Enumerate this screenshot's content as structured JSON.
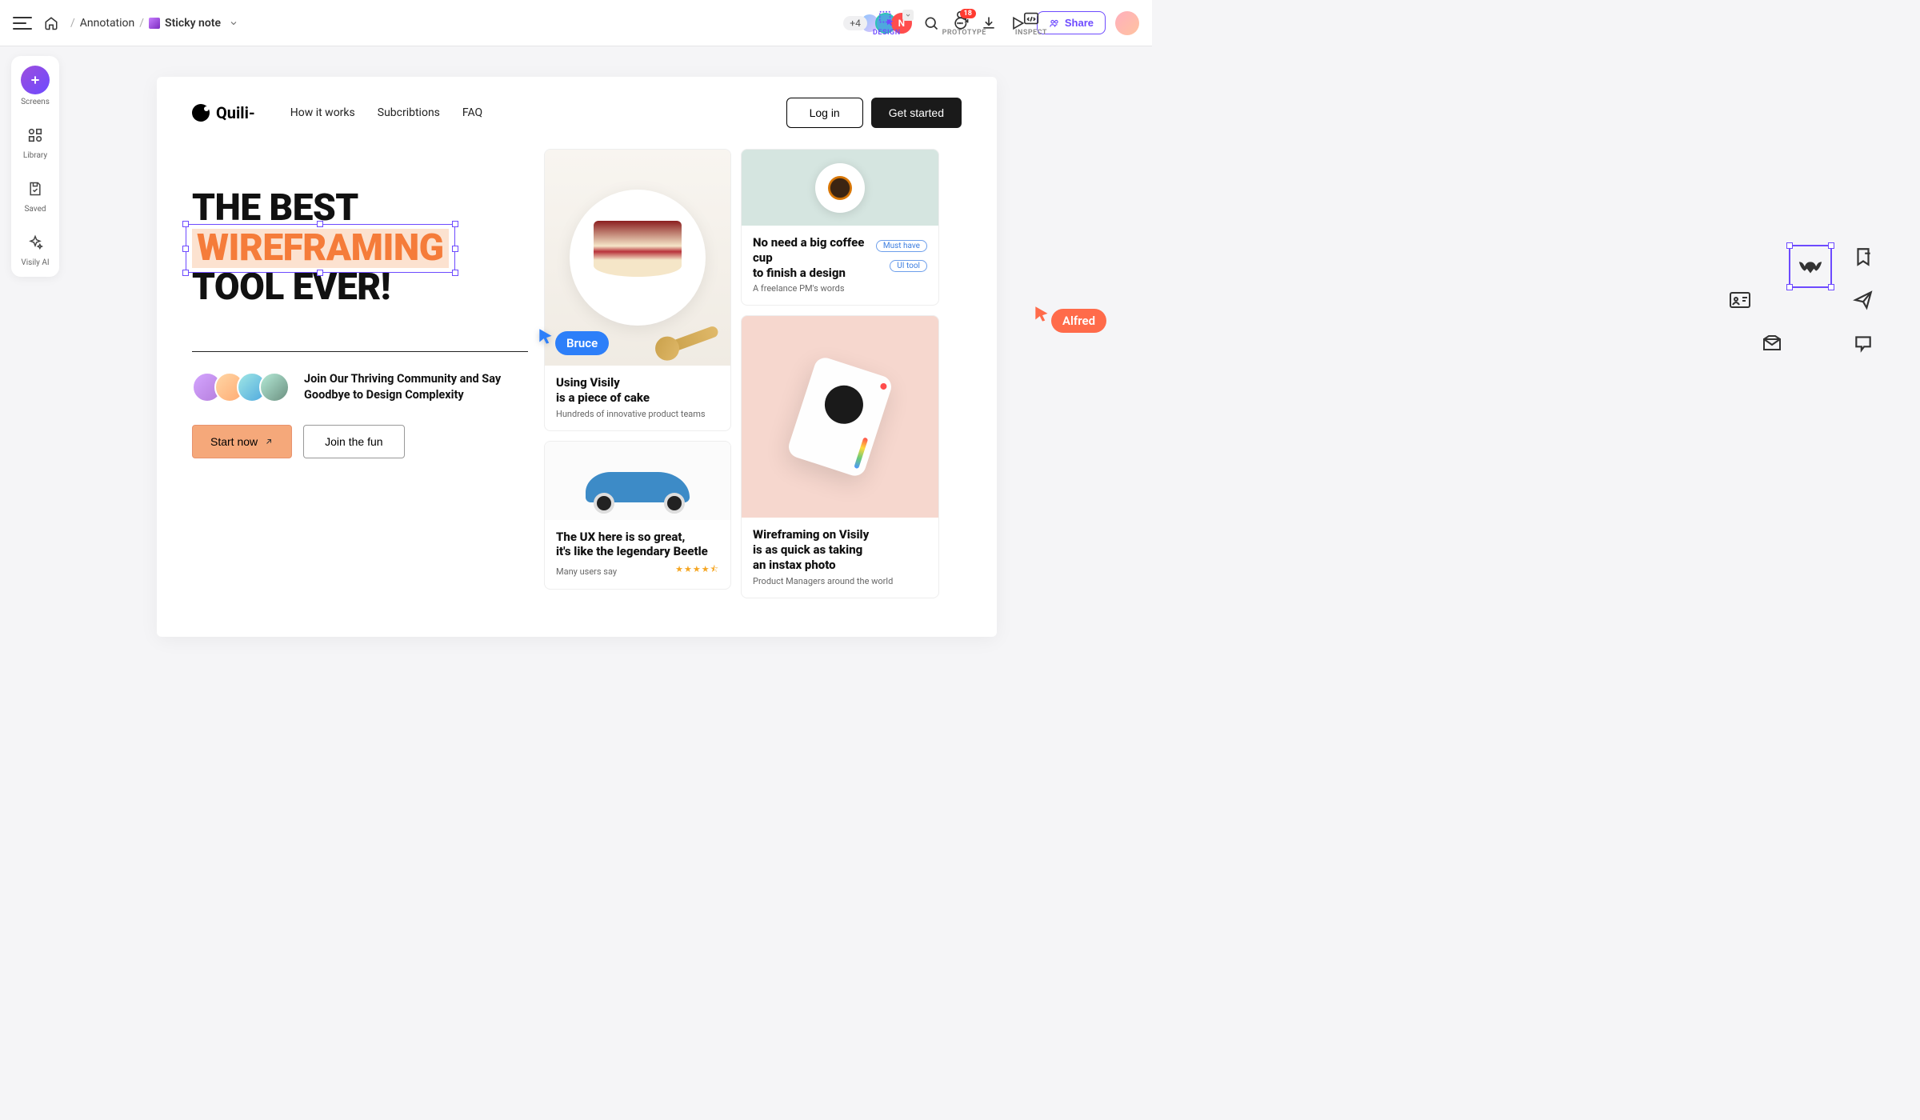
{
  "breadcrumb": {
    "parent": "Annotation",
    "current": "Sticky note"
  },
  "modes": {
    "design": "DESIGN",
    "prototype": "PROTOTYPE",
    "inspect": "INSPECT"
  },
  "topbar": {
    "more_count": "+4",
    "avatar_n": "N",
    "comment_badge": "18",
    "share": "Share"
  },
  "sidebar": {
    "screens": "Screens",
    "library": "Library",
    "saved": "Saved",
    "ai": "Visily AI"
  },
  "site": {
    "logo": "Quili-",
    "nav": {
      "how": "How it works",
      "subs": "Subcribtions",
      "faq": "FAQ"
    },
    "login": "Log in",
    "getstarted": "Get started"
  },
  "hero": {
    "line1": "THE BEST",
    "highlight": "WIREFRAMING",
    "line3": "TOOL EVER!",
    "community": "Join Our Thriving Community and Say Goodbye to Design Complexity",
    "start": "Start now",
    "join": "Join the fun"
  },
  "cards": {
    "cake": {
      "title1": "Using Visily",
      "title2": "is a piece of cake",
      "sub": "Hundreds of innovative product teams"
    },
    "coffee": {
      "title1": "No need a big coffee cup",
      "title2": "to finish a design",
      "sub": "A freelance PM's words",
      "tag1": "Must have",
      "tag2": "UI tool"
    },
    "beetle": {
      "title1": "The UX here is so great,",
      "title2": "it's like the legendary Beetle",
      "sub": "Many users say",
      "stars": "★★★★⯪"
    },
    "instax": {
      "title1": "Wireframing on Visily",
      "title2": "is as quick as taking",
      "title3": "an instax photo",
      "sub": "Product Managers around the world"
    }
  },
  "cursors": {
    "bruce": "Bruce",
    "alfred": "Alfred"
  }
}
